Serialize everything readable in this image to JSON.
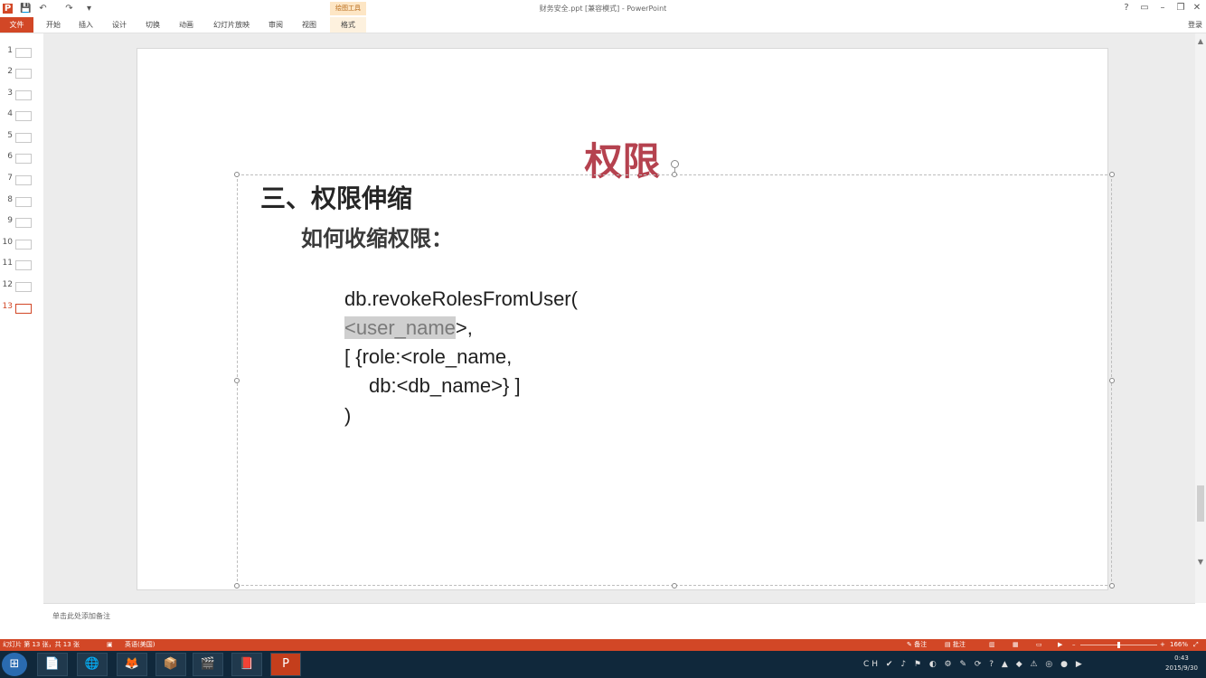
{
  "window": {
    "title": "财务安全.ppt [兼容模式] - PowerPoint",
    "context_group": "绘图工具",
    "controls": {
      "help": "?",
      "ribbon_options": "▭",
      "minimize": "–",
      "restore": "❐",
      "close": "✕"
    }
  },
  "quick_access": {
    "save": "💾",
    "undo": "↶",
    "redo": "↷",
    "customize": "▾"
  },
  "ribbon": {
    "file_tab": "文件",
    "tabs": [
      "开始",
      "插入",
      "设计",
      "切换",
      "动画",
      "幻灯片放映",
      "审阅",
      "视图",
      "格式"
    ],
    "signin": "登录"
  },
  "thumbnails": {
    "numbers": [
      "1",
      "2",
      "3",
      "4",
      "5",
      "6",
      "7",
      "8",
      "9",
      "10",
      "11",
      "12",
      "13"
    ],
    "active": "13"
  },
  "slide": {
    "title": "权限",
    "heading1": "三、权限伸缩",
    "heading2": "如何收缩权限：",
    "code": {
      "line1": "db.revokeRolesFromUser(",
      "line2_selected": "<user_name",
      "line2_rest": ">,",
      "line3": "[ {role:<role_name,",
      "line4": "db:<db_name>} ]",
      "line5": ")"
    }
  },
  "notes": {
    "placeholder": "单击此处添加备注"
  },
  "status": {
    "slide_info": "幻灯片 第 13 张，共 13 张",
    "language": "英语(美国)",
    "notes_btn": "备注",
    "comments_btn": "批注",
    "zoom": "166%"
  },
  "taskbar": {
    "apps": [
      "📄",
      "🌐",
      "🦊",
      "📦",
      "🎬",
      "📕",
      "P"
    ],
    "tray": "CH ✔ ♪ ⚑ ◐ ⚙ ✎ ⟳ ? ▲ ◆ ⚠ ◎ ● ▶",
    "time": "0:43",
    "date": "2015/9/30"
  },
  "colors": {
    "accent": "#d24726",
    "slide_title": "#b5424f",
    "taskbar": "#10283b"
  }
}
